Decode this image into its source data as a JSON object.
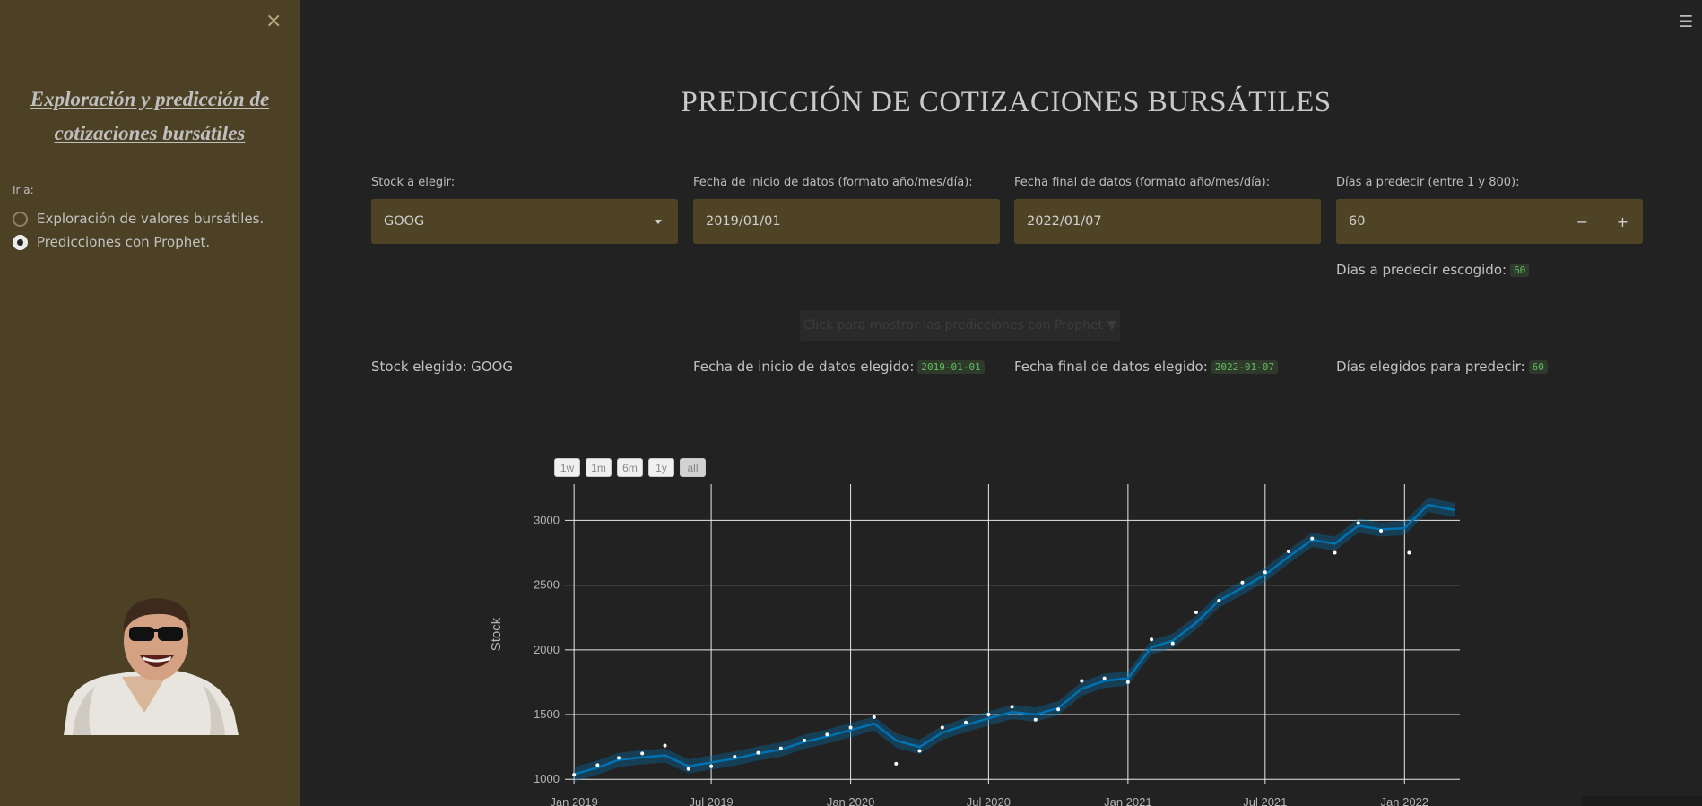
{
  "sidebar": {
    "close_icon": "×",
    "title": "Exploración y predicción de cotizaciones bursátiles",
    "goto_label": "Ir a:",
    "options": [
      {
        "label": "Exploración de valores bursátiles.",
        "selected": false
      },
      {
        "label": "Predicciones con Prophet.",
        "selected": true
      }
    ]
  },
  "header": {
    "menu_icon": "☰"
  },
  "main": {
    "title": "PREDICCIÓN DE COTIZACIONES BURSÁTILES",
    "stock_label": "Stock a elegir:",
    "stock_value": "GOOG",
    "start_label": "Fecha de inicio de datos (formato año/mes/día):",
    "start_value": "2019/01/01",
    "end_label": "Fecha final de datos (formato año/mes/día):",
    "end_value": "2022/01/07",
    "days_label": "Días a predecir (entre 1 y 800):",
    "days_value": "60",
    "minus": "−",
    "plus": "+",
    "days_chosen_label": "Días a predecir escogido:",
    "days_chosen_value": "60",
    "faded_button": "Click para mostrar las predicciones con Prophet ▼",
    "info_stock": "Stock elegido: GOOG",
    "info_start_label": "Fecha de inicio de datos elegido:",
    "info_start_value": "2019-01-01",
    "info_end_label": "Fecha final de datos elegido:",
    "info_end_value": "2022-01-07",
    "info_days_label": "Días elegidos para predecir:",
    "info_days_value": "60"
  },
  "chart_controls": {
    "buttons": [
      "1w",
      "1m",
      "6m",
      "1y",
      "all"
    ],
    "active": "all"
  },
  "colors": {
    "sidebar_bg": "#4c4125",
    "field_bg": "#4f4326",
    "forecast_line": "#0072b2",
    "page_bg": "#222222"
  },
  "chart_data": {
    "type": "line",
    "ylabel": "Stock",
    "xlabel": "",
    "x_ticks": [
      "Jan 2019",
      "Jul 2019",
      "Jan 2020",
      "Jul 2020",
      "Jan 2021",
      "Jul 2021",
      "Jan 2022"
    ],
    "y_ticks": [
      1000,
      1500,
      2000,
      2500,
      3000
    ],
    "ylim": [
      960,
      3280
    ],
    "xlim": [
      "2018-12-20",
      "2022-03-15"
    ],
    "grid": true,
    "series": [
      {
        "kind": "forecast",
        "points": [
          [
            "2019-01-01",
            1040
          ],
          [
            "2019-02-01",
            1090
          ],
          [
            "2019-03-01",
            1150
          ],
          [
            "2019-04-01",
            1170
          ],
          [
            "2019-05-01",
            1185
          ],
          [
            "2019-06-01",
            1100
          ],
          [
            "2019-07-01",
            1130
          ],
          [
            "2019-08-01",
            1160
          ],
          [
            "2019-09-01",
            1200
          ],
          [
            "2019-10-01",
            1230
          ],
          [
            "2019-11-01",
            1290
          ],
          [
            "2019-12-01",
            1330
          ],
          [
            "2020-01-01",
            1380
          ],
          [
            "2020-02-01",
            1430
          ],
          [
            "2020-03-01",
            1300
          ],
          [
            "2020-04-01",
            1250
          ],
          [
            "2020-05-01",
            1360
          ],
          [
            "2020-06-01",
            1420
          ],
          [
            "2020-07-01",
            1470
          ],
          [
            "2020-08-01",
            1520
          ],
          [
            "2020-09-01",
            1500
          ],
          [
            "2020-10-01",
            1550
          ],
          [
            "2020-11-01",
            1700
          ],
          [
            "2020-12-01",
            1760
          ],
          [
            "2021-01-01",
            1780
          ],
          [
            "2021-02-01",
            2020
          ],
          [
            "2021-03-01",
            2070
          ],
          [
            "2021-04-01",
            2210
          ],
          [
            "2021-05-01",
            2380
          ],
          [
            "2021-06-01",
            2480
          ],
          [
            "2021-07-01",
            2580
          ],
          [
            "2021-08-01",
            2720
          ],
          [
            "2021-09-01",
            2850
          ],
          [
            "2021-10-01",
            2820
          ],
          [
            "2021-11-01",
            2960
          ],
          [
            "2021-12-01",
            2930
          ],
          [
            "2022-01-01",
            2940
          ],
          [
            "2022-02-01",
            3120
          ],
          [
            "2022-03-08",
            3080
          ]
        ]
      },
      {
        "kind": "actual",
        "points": [
          [
            "2019-01-01",
            1035
          ],
          [
            "2019-02-01",
            1110
          ],
          [
            "2019-03-01",
            1165
          ],
          [
            "2019-04-01",
            1200
          ],
          [
            "2019-05-01",
            1260
          ],
          [
            "2019-06-01",
            1080
          ],
          [
            "2019-07-01",
            1100
          ],
          [
            "2019-08-01",
            1175
          ],
          [
            "2019-09-01",
            1205
          ],
          [
            "2019-10-01",
            1240
          ],
          [
            "2019-11-01",
            1300
          ],
          [
            "2019-12-01",
            1345
          ],
          [
            "2020-01-01",
            1400
          ],
          [
            "2020-02-01",
            1480
          ],
          [
            "2020-03-01",
            1120
          ],
          [
            "2020-04-01",
            1220
          ],
          [
            "2020-05-01",
            1400
          ],
          [
            "2020-06-01",
            1440
          ],
          [
            "2020-07-01",
            1500
          ],
          [
            "2020-08-01",
            1560
          ],
          [
            "2020-09-01",
            1460
          ],
          [
            "2020-10-01",
            1540
          ],
          [
            "2020-11-01",
            1760
          ],
          [
            "2020-12-01",
            1780
          ],
          [
            "2021-01-01",
            1750
          ],
          [
            "2021-02-01",
            2080
          ],
          [
            "2021-03-01",
            2050
          ],
          [
            "2021-04-01",
            2290
          ],
          [
            "2021-05-01",
            2380
          ],
          [
            "2021-06-01",
            2520
          ],
          [
            "2021-07-01",
            2600
          ],
          [
            "2021-08-01",
            2760
          ],
          [
            "2021-09-01",
            2860
          ],
          [
            "2021-10-01",
            2750
          ],
          [
            "2021-11-01",
            2980
          ],
          [
            "2021-12-01",
            2920
          ],
          [
            "2022-01-07",
            2750
          ]
        ]
      }
    ]
  }
}
